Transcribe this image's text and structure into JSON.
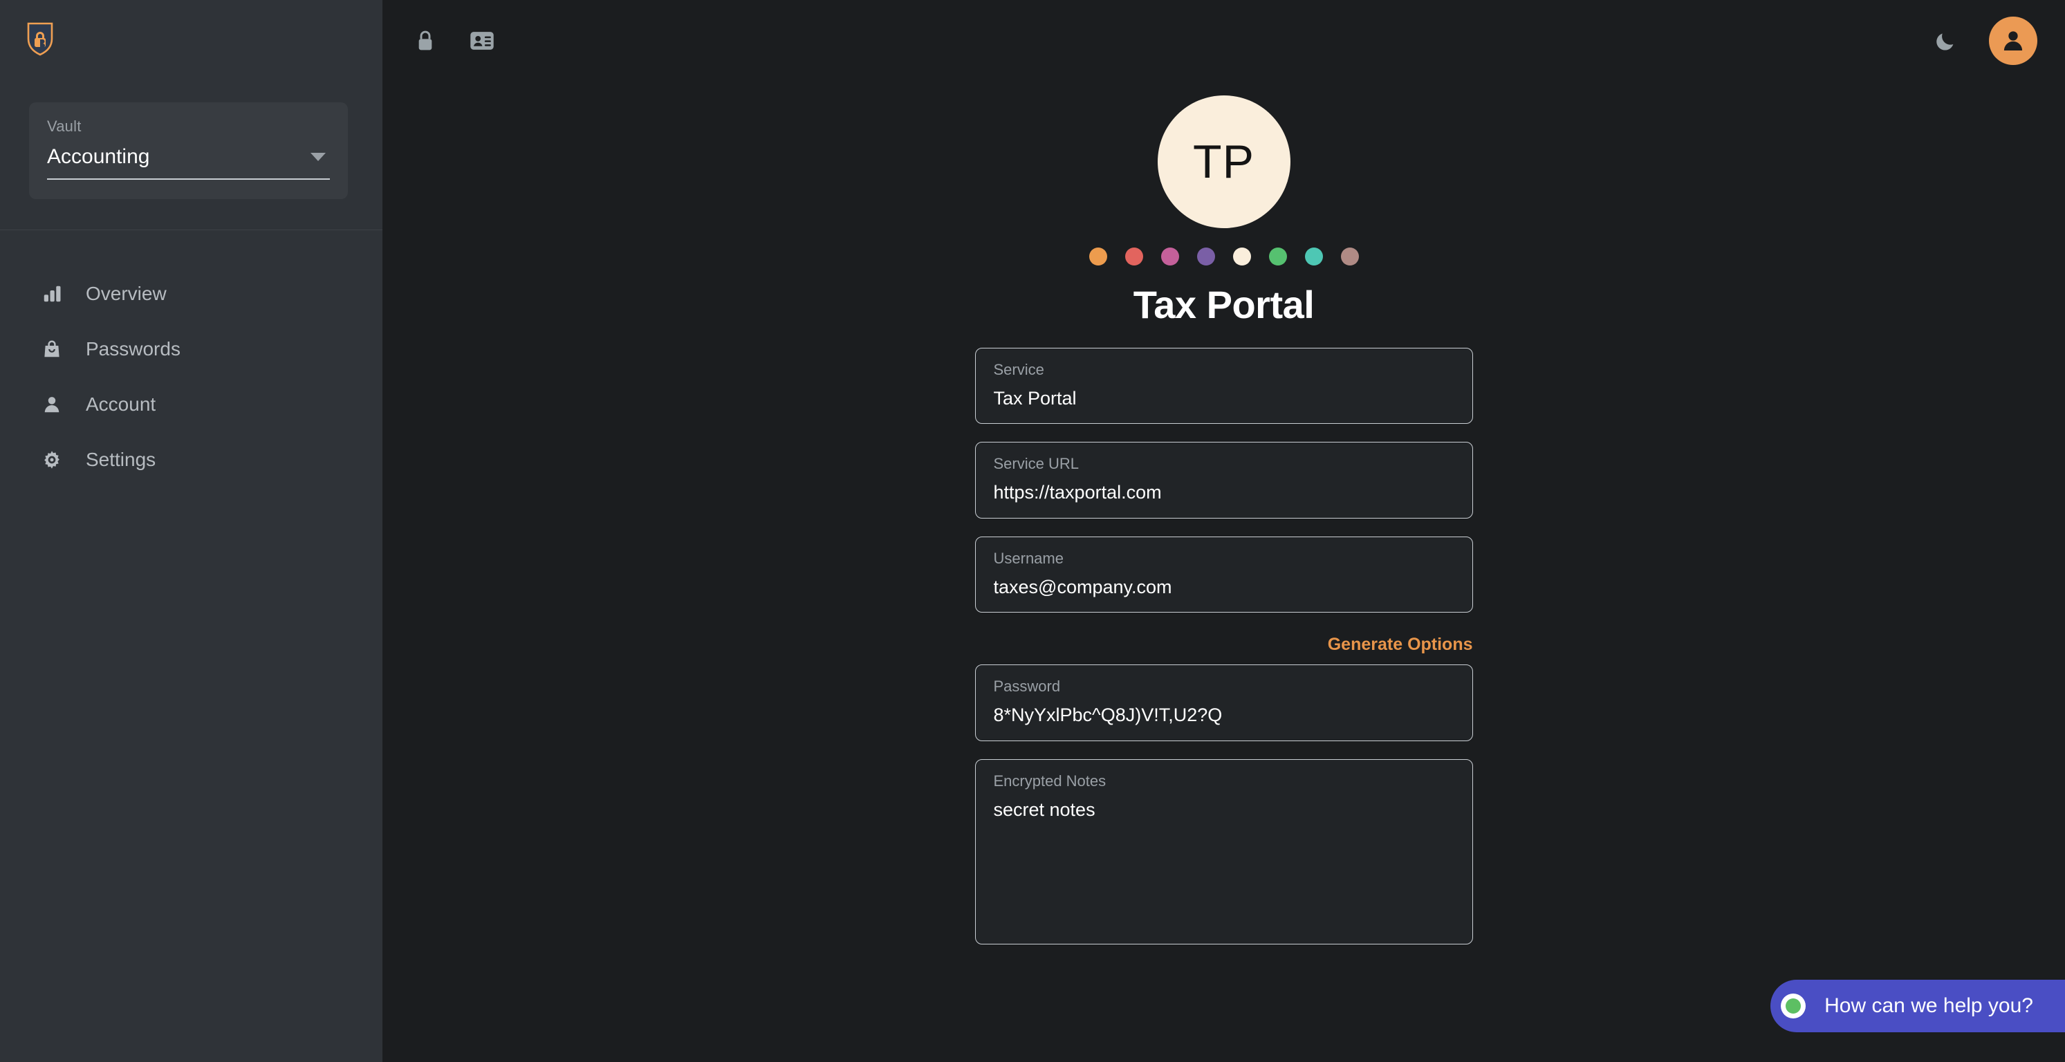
{
  "sidebar": {
    "logo_icon": "shield-lock-logo-icon",
    "vault": {
      "label": "Vault",
      "value": "Accounting",
      "caret_icon": "chevron-down-icon"
    },
    "items": [
      {
        "label": "Overview",
        "icon": "bar-chart-icon"
      },
      {
        "label": "Passwords",
        "icon": "lock-bag-icon"
      },
      {
        "label": "Account",
        "icon": "person-icon"
      },
      {
        "label": "Settings",
        "icon": "gear-icon"
      }
    ]
  },
  "topbar": {
    "lock_icon": "padlock-icon",
    "contact_card_icon": "contact-card-icon",
    "theme_icon": "moon-icon",
    "avatar_icon": "user-avatar-icon"
  },
  "main": {
    "avatar_initials": "TP",
    "title": "Tax Portal",
    "swatches": [
      {
        "name": "orange",
        "color": "#ed9c4e"
      },
      {
        "name": "red",
        "color": "#e2645e"
      },
      {
        "name": "pink",
        "color": "#c4609a"
      },
      {
        "name": "purple",
        "color": "#7a5fa6"
      },
      {
        "name": "cream",
        "color": "#faeedc"
      },
      {
        "name": "green",
        "color": "#56c170"
      },
      {
        "name": "teal",
        "color": "#4ec7b4"
      },
      {
        "name": "rose",
        "color": "#b08b85"
      }
    ],
    "selected_swatch": "cream",
    "generate_options_label": "Generate Options",
    "fields": {
      "service": {
        "label": "Service",
        "value": "Tax Portal"
      },
      "url": {
        "label": "Service URL",
        "value": "https://taxportal.com"
      },
      "username": {
        "label": "Username",
        "value": "taxes@company.com"
      },
      "password": {
        "label": "Password",
        "value": "8*NyYxlPbc^Q8J)V!T,U2?Q"
      },
      "notes": {
        "label": "Encrypted Notes",
        "value": "secret notes"
      }
    }
  },
  "chat": {
    "message": "How can we help you?",
    "status_color": "#5dbf63"
  },
  "colors": {
    "sidebar_bg": "#2f3338",
    "main_bg": "#1b1d1f",
    "accent_orange": "#e8954a",
    "chat_purple": "#4a4ec4",
    "avatar_cream": "#faeedc"
  }
}
